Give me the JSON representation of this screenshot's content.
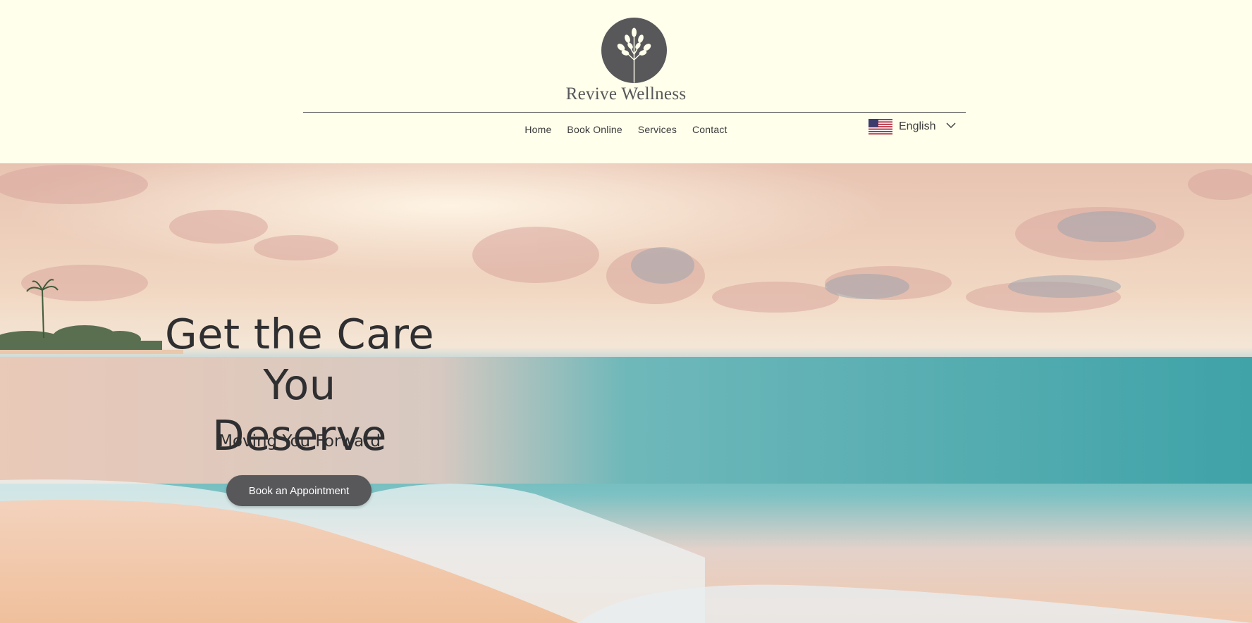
{
  "site": {
    "title": "Revive Wellness",
    "logo_icon": "tree-icon",
    "brand_color": "#58585B",
    "header_bg": "#FFFFEB"
  },
  "nav": {
    "items": [
      {
        "label": "Home"
      },
      {
        "label": "Book Online"
      },
      {
        "label": "Services"
      },
      {
        "label": "Contact"
      }
    ]
  },
  "language": {
    "selected": "English",
    "flag_icon": "us-flag-icon",
    "dropdown_icon": "chevron-down-icon"
  },
  "hero": {
    "title_line1": "Get the Care You",
    "title_line2": "Deserve",
    "subtitle": "Moving You Forward",
    "cta_label": "Book an Appointment",
    "background": "beach-sunset-image"
  }
}
